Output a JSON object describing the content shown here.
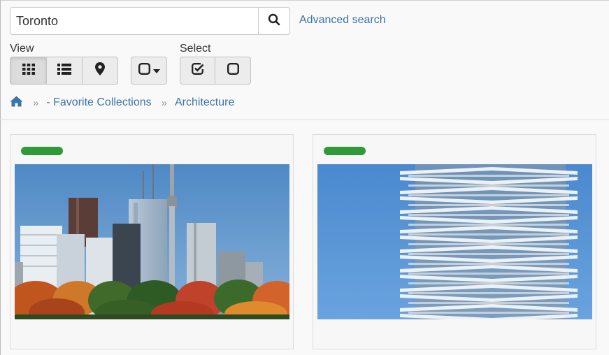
{
  "search": {
    "value": "Toronto",
    "advanced_label": "Advanced search"
  },
  "view": {
    "label": "View",
    "buttons": [
      "grid-view",
      "list-view",
      "map-view"
    ],
    "active": "grid-view"
  },
  "select": {
    "label": "Select",
    "buttons": [
      "select-all",
      "deselect-all"
    ]
  },
  "breadcrumb": {
    "items": [
      "- Favorite Collections",
      "Architecture"
    ]
  },
  "cards": [
    {
      "image": "toronto-skyline-autumn",
      "status_color": "#2f9a38"
    },
    {
      "image": "stacked-residential-tower",
      "status_color": "#2f9a38"
    }
  ],
  "colors": {
    "link": "#3d74a5",
    "status": "#2f9a38"
  }
}
